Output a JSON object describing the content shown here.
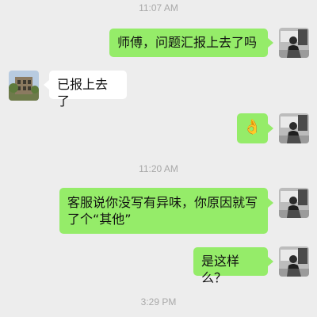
{
  "timestamps": [
    "11:07 AM",
    "11:20 AM",
    "3:29 PM"
  ],
  "messages": [
    {
      "side": "out",
      "text": "师傅，问题汇报上去了吗"
    },
    {
      "side": "in",
      "text": "已报上去了"
    },
    {
      "side": "out",
      "emoji": "👌",
      "emoji_name": "ok-hand"
    },
    {
      "side": "out",
      "text": "客服说你没写有异味，你原因就写了个“其他”"
    },
    {
      "side": "out",
      "text": "是这样么？"
    }
  ],
  "colors": {
    "background": "#ededed",
    "outgoing_bubble": "#95ec69",
    "incoming_bubble": "#ffffff",
    "timestamp_text": "#a9a9a9"
  }
}
